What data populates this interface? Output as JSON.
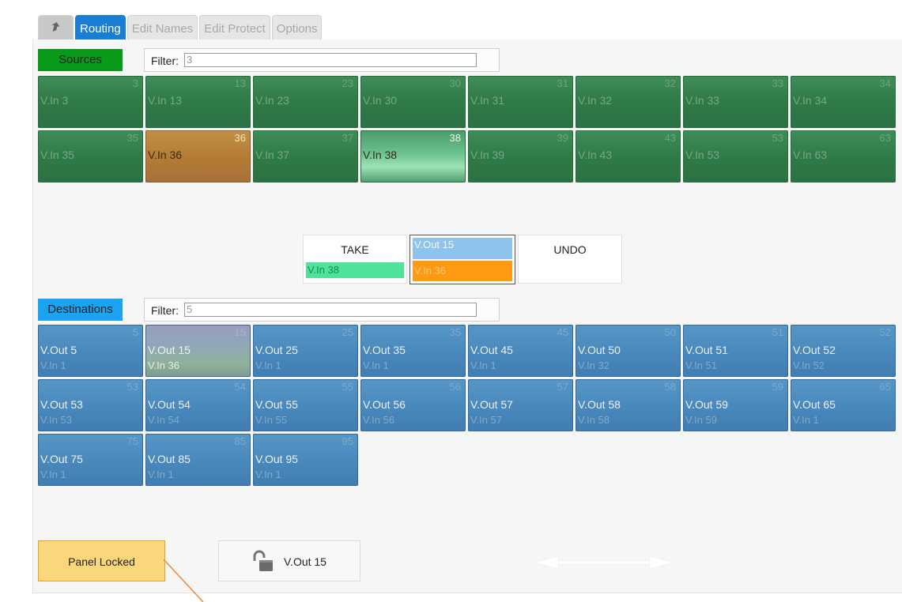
{
  "tabs": {
    "back_icon": "back-arrow-icon",
    "items": [
      "Routing",
      "Edit Names",
      "Edit Protect",
      "Options"
    ],
    "active": "Routing"
  },
  "sources": {
    "label": "Sources",
    "label_color": "#0a9a1a",
    "filter_label": "Filter:",
    "filter_value": "3",
    "buttons": [
      {
        "num": "3",
        "name": "V.In 3",
        "state": "normal"
      },
      {
        "num": "13",
        "name": "V.In 13",
        "state": "normal"
      },
      {
        "num": "23",
        "name": "V.In 23",
        "state": "normal"
      },
      {
        "num": "30",
        "name": "V.In 30",
        "state": "normal"
      },
      {
        "num": "31",
        "name": "V.In 31",
        "state": "normal"
      },
      {
        "num": "32",
        "name": "V.In 32",
        "state": "normal"
      },
      {
        "num": "33",
        "name": "V.In 33",
        "state": "normal"
      },
      {
        "num": "34",
        "name": "V.In 34",
        "state": "normal"
      },
      {
        "num": "35",
        "name": "V.In 35",
        "state": "normal"
      },
      {
        "num": "36",
        "name": "V.In 36",
        "state": "pending"
      },
      {
        "num": "37",
        "name": "V.In 37",
        "state": "normal"
      },
      {
        "num": "38",
        "name": "V.In 38",
        "state": "selected"
      },
      {
        "num": "39",
        "name": "V.In 39",
        "state": "normal"
      },
      {
        "num": "43",
        "name": "V.In 43",
        "state": "normal"
      },
      {
        "num": "53",
        "name": "V.In 53",
        "state": "normal"
      },
      {
        "num": "63",
        "name": "V.In 63",
        "state": "normal"
      }
    ]
  },
  "take": {
    "label": "TAKE",
    "source": "V.In 38",
    "preview_dest": "V.Out 15",
    "preview_source": "V.In 36",
    "undo": "UNDO"
  },
  "destinations": {
    "label": "Destinations",
    "label_color": "#1aa3f0",
    "filter_label": "Filter:",
    "filter_value": "5",
    "buttons": [
      {
        "num": "5",
        "name": "V.Out 5",
        "src": "V.In 1",
        "state": "normal"
      },
      {
        "num": "15",
        "name": "V.Out 15",
        "src": "V.In 36",
        "state": "selected"
      },
      {
        "num": "25",
        "name": "V.Out 25",
        "src": "V.In 1",
        "state": "normal"
      },
      {
        "num": "35",
        "name": "V.Out 35",
        "src": "V.In 1",
        "state": "normal"
      },
      {
        "num": "45",
        "name": "V.Out 45",
        "src": "V.In 1",
        "state": "normal"
      },
      {
        "num": "50",
        "name": "V.Out 50",
        "src": "V.In 32",
        "state": "normal"
      },
      {
        "num": "51",
        "name": "V.Out 51",
        "src": "V.In 51",
        "state": "normal"
      },
      {
        "num": "52",
        "name": "V.Out 52",
        "src": "V.In 52",
        "state": "normal"
      },
      {
        "num": "53",
        "name": "V.Out 53",
        "src": "V.In 53",
        "state": "normal"
      },
      {
        "num": "54",
        "name": "V.Out 54",
        "src": "V.In 54",
        "state": "normal"
      },
      {
        "num": "55",
        "name": "V.Out 55",
        "src": "V.In 55",
        "state": "normal"
      },
      {
        "num": "56",
        "name": "V.Out 56",
        "src": "V.In 56",
        "state": "normal"
      },
      {
        "num": "57",
        "name": "V.Out 57",
        "src": "V.In 57",
        "state": "normal"
      },
      {
        "num": "58",
        "name": "V.Out 58",
        "src": "V.In 58",
        "state": "normal"
      },
      {
        "num": "59",
        "name": "V.Out 59",
        "src": "V.In 59",
        "state": "normal"
      },
      {
        "num": "65",
        "name": "V.Out 65",
        "src": "V.In 1",
        "state": "normal"
      },
      {
        "num": "75",
        "name": "V.Out 75",
        "src": "V.In 1",
        "state": "normal"
      },
      {
        "num": "85",
        "name": "V.Out 85",
        "src": "V.In 1",
        "state": "normal"
      },
      {
        "num": "95",
        "name": "V.Out 95",
        "src": "V.In 1",
        "state": "normal"
      }
    ]
  },
  "footer": {
    "panel_locked": "Panel Locked",
    "lock_target": "V.Out 15",
    "lock_icon": "unlocked-padlock-icon",
    "scroll_icon": "double-arrow-icon"
  }
}
